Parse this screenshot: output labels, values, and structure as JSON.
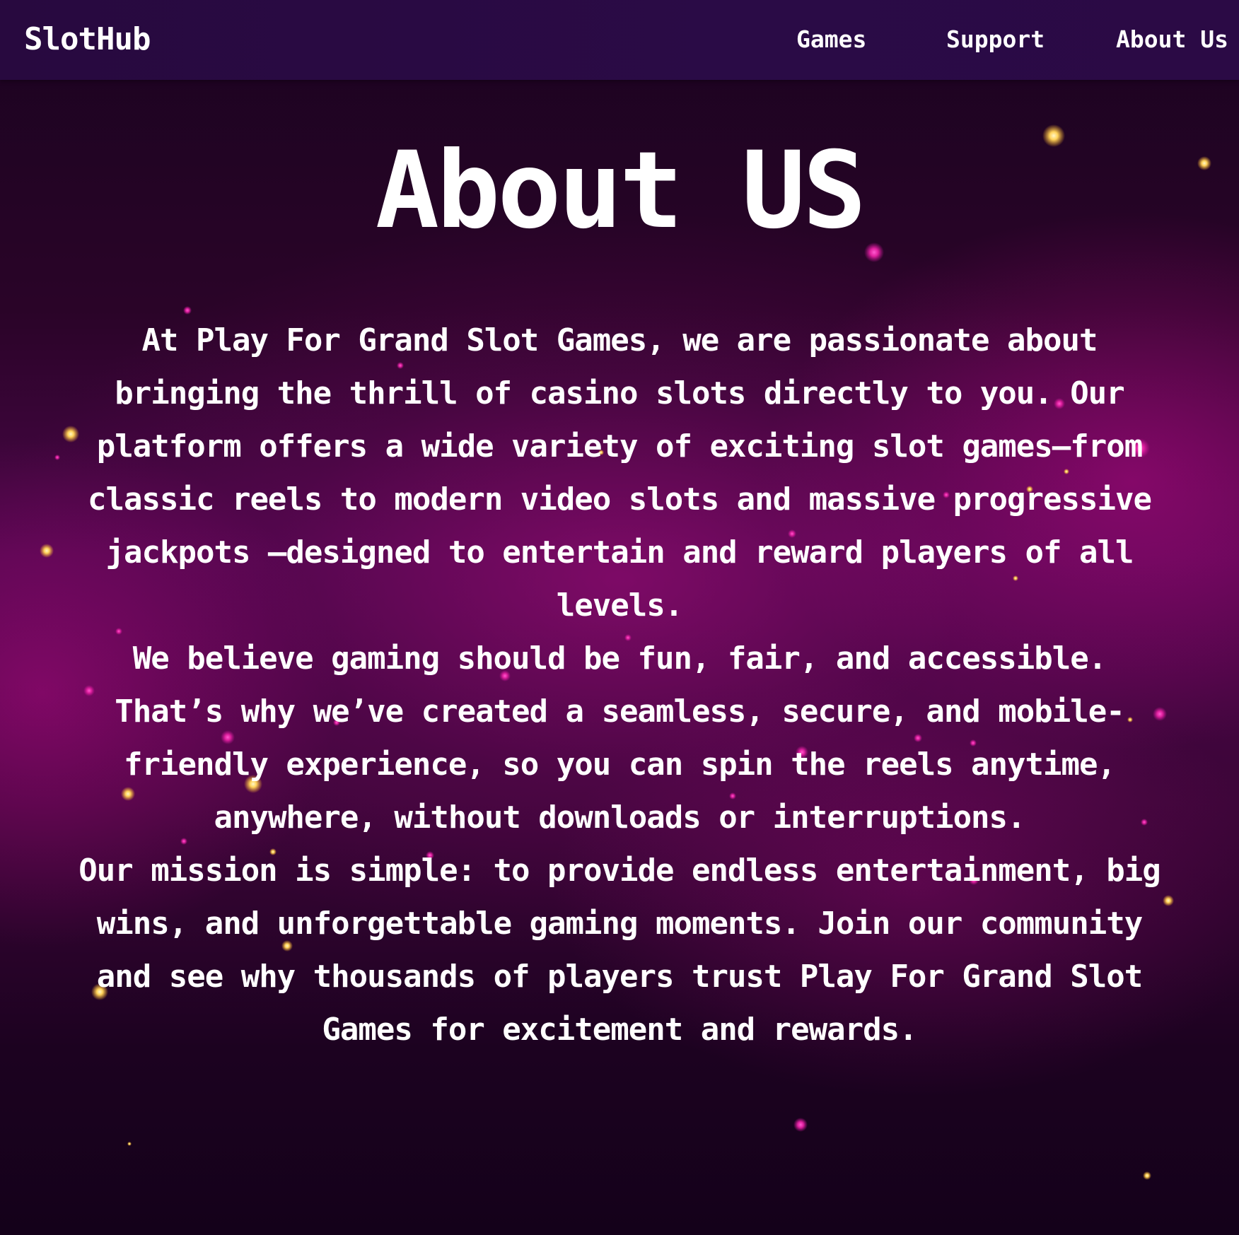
{
  "header": {
    "logo": "SlotHub",
    "nav": {
      "games": "Games",
      "support": "Support",
      "about": "About Us"
    }
  },
  "main": {
    "title": "About US",
    "paragraphs": [
      "At Play For Grand Slot Games, we are passionate about bringing the thrill of casino slots directly to you. Our platform offers a wide variety of exciting slot games—from classic reels to modern video slots and massive progressive jackpots —designed to entertain and reward players of all levels.",
      "We believe gaming should be fun, fair, and accessible. That’s why we’ve created a seamless, secure, and mobile-friendly experience, so you can spin the reels anytime, anywhere, without downloads or interruptions.",
      "Our mission is simple: to provide endless entertainment, big wins, and unforgettable gaming moments. Join our community and see why thousands of players trust Play For Grand Slot Games for excitement and rewards."
    ]
  },
  "colors": {
    "navbar": "#2a0b46",
    "background": "#2a0428",
    "glow": "#a80e80",
    "particle": "#ffd35a",
    "text": "#ffffff"
  }
}
